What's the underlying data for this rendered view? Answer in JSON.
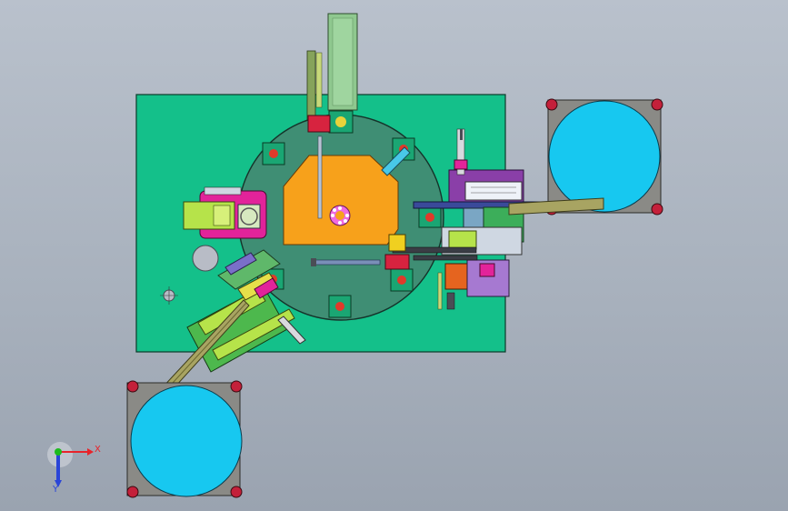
{
  "viewport": {
    "background_top": "#b9c1cc",
    "background_bottom": "#9aa3b0"
  },
  "model": {
    "base_plate_color": "#14c08a",
    "turntable_color": "#3f8e74",
    "center_plate_color": "#f7a11b",
    "feeder_bowl_color": "#17c8f0",
    "feeder_frame_color": "#8a8a86",
    "magenta_block_color": "#e2239a",
    "lime_block_color": "#b6e34a"
  },
  "triad": {
    "x_label": "X",
    "y_label": "Y",
    "x_color": "#e8232a",
    "y_color": "#1dbb1d",
    "z_color": "#2a45d8"
  }
}
